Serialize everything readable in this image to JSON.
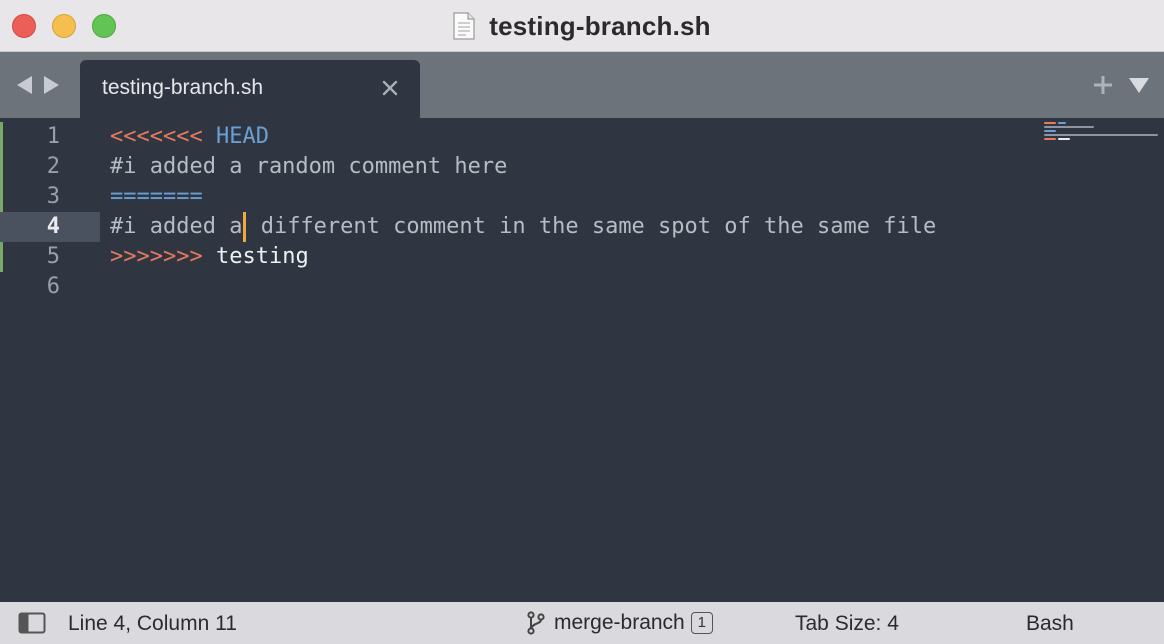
{
  "window": {
    "title": "testing-branch.sh"
  },
  "tabs": [
    {
      "label": "testing-branch.sh",
      "active": true
    }
  ],
  "editor": {
    "lines": [
      {
        "number": "1",
        "segments": [
          {
            "text": "<<<<<<<",
            "style": "red"
          },
          {
            "text": " ",
            "style": "plain"
          },
          {
            "text": "HEAD",
            "style": "blue"
          }
        ]
      },
      {
        "number": "2",
        "segments": [
          {
            "text": "#i added a random comment here",
            "style": "plain"
          }
        ]
      },
      {
        "number": "3",
        "segments": [
          {
            "text": "=======",
            "style": "blue"
          }
        ]
      },
      {
        "number": "4",
        "before_caret": "#i added a",
        "after_caret": " different comment in the same spot of the same file"
      },
      {
        "number": "5",
        "segments": [
          {
            "text": ">>>>>>>",
            "style": "red"
          },
          {
            "text": " ",
            "style": "plain"
          },
          {
            "text": "testing",
            "style": "white"
          }
        ]
      },
      {
        "number": "6",
        "segments": []
      }
    ],
    "active_line": "4"
  },
  "statusbar": {
    "position": "Line 4, Column 11",
    "branch": "merge-branch",
    "branch_badge": "1",
    "tab_size": "Tab Size: 4",
    "syntax": "Bash"
  },
  "colors": {
    "editor_bg": "#303641",
    "marker_red": "#e77a5f",
    "marker_blue": "#6a9fd4",
    "caret": "#f2a83a",
    "gutter_change": "#7aa867"
  },
  "icons": [
    "file-icon",
    "back-arrow-icon",
    "forward-arrow-icon",
    "close-icon",
    "plus-icon",
    "dropdown-triangle-icon",
    "sidebar-toggle-icon",
    "git-branch-icon"
  ]
}
